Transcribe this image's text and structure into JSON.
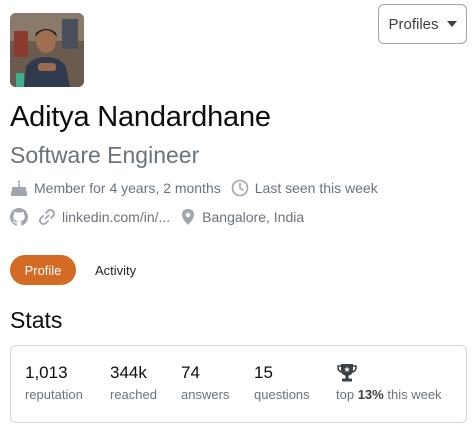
{
  "header": {
    "profiles_label": "Profiles"
  },
  "user": {
    "name": "Aditya Nandardhane",
    "title": "Software Engineer",
    "member_for": "Member for 4 years, 2 months",
    "last_seen": "Last seen this week",
    "linkedin": "linkedin.com/in/...",
    "location": "Bangalore, India"
  },
  "tabs": [
    {
      "label": "Profile",
      "active": true
    },
    {
      "label": "Activity",
      "active": false
    }
  ],
  "stats": {
    "heading": "Stats",
    "items": [
      {
        "value": "1,013",
        "label": "reputation"
      },
      {
        "value": "344k",
        "label": "reached"
      },
      {
        "value": "74",
        "label": "answers"
      },
      {
        "value": "15",
        "label": "questions"
      }
    ],
    "top": {
      "prefix": "top",
      "percent": "13%",
      "suffix": "this week"
    }
  },
  "colors": {
    "accent": "#d46b25",
    "muted": "#6a737c",
    "border": "#d6d9dc"
  },
  "icons": [
    "cake-icon",
    "clock-icon",
    "github-icon",
    "link-icon",
    "location-pin-icon",
    "trophy-icon",
    "caret-down-icon"
  ]
}
